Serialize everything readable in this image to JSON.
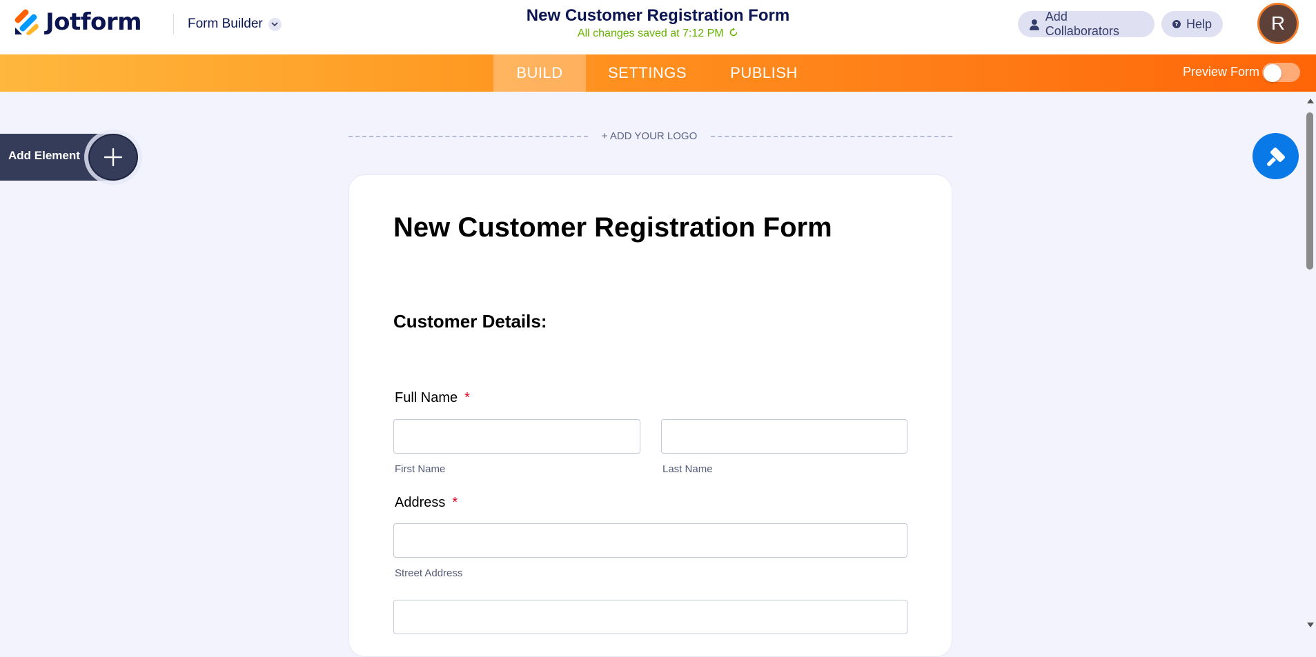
{
  "header": {
    "brand": "Jotform",
    "builder_menu_label": "Form Builder",
    "form_title": "New Customer Registration Form",
    "save_status": "All changes saved at 7:12 PM",
    "collaborators_label": "Add Collaborators",
    "help_label": "Help",
    "avatar_initial": "R"
  },
  "nav": {
    "tabs": [
      {
        "label": "BUILD",
        "active": true
      },
      {
        "label": "SETTINGS",
        "active": false
      },
      {
        "label": "PUBLISH",
        "active": false
      }
    ],
    "preview_label": "Preview Form",
    "preview_enabled": false
  },
  "sidebar": {
    "add_element_label": "Add Element"
  },
  "canvas": {
    "add_logo_label": "+ ADD YOUR LOGO",
    "form_heading": "New Customer Registration Form",
    "section_heading": "Customer Details:",
    "fields": {
      "full_name": {
        "label": "Full Name",
        "required_mark": "*",
        "first_sublabel": "First Name",
        "last_sublabel": "Last Name",
        "first_value": "",
        "last_value": ""
      },
      "address": {
        "label": "Address",
        "required_mark": "*",
        "street_sublabel": "Street Address",
        "street_value": "",
        "line2_value": ""
      }
    }
  },
  "colors": {
    "brand_navy": "#0a1551",
    "save_green": "#64b200",
    "nav_gradient_start": "#ffb73d",
    "nav_gradient_end": "#ff6508",
    "designer_blue": "#0a79e8",
    "required_red": "#e5001c"
  },
  "icons": {
    "logo": "jotform-logo-icon",
    "builder_menu": "chevron-down-icon",
    "collaborators": "user-icon",
    "help": "question-circle-icon",
    "add_element": "plus-icon",
    "designer": "paint-roller-icon",
    "save_status": "refresh-icon"
  }
}
